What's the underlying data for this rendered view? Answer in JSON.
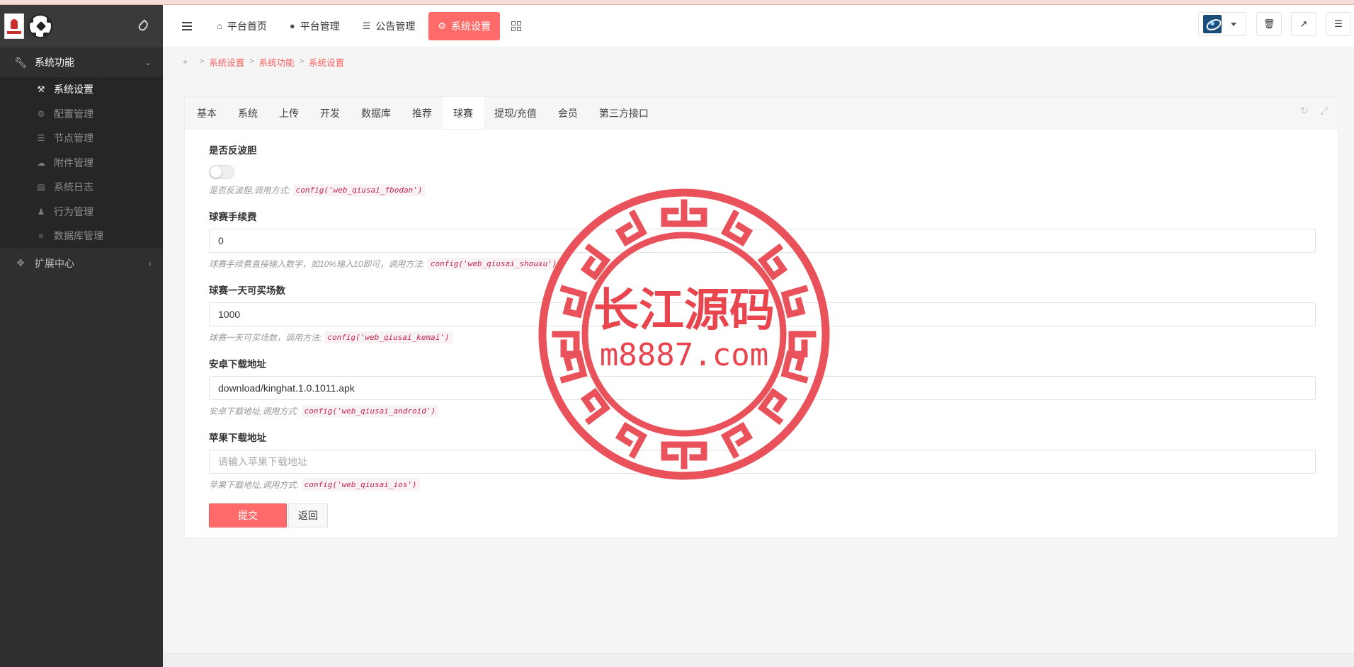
{
  "sidebar": {
    "groups": [
      {
        "label": "系统功能",
        "icon": "wrench-icon"
      },
      {
        "label": "扩展中心",
        "icon": "layers-icon"
      }
    ],
    "items": [
      {
        "label": "系统设置",
        "icon": "wrench-icon"
      },
      {
        "label": "配置管理",
        "icon": "gears-icon"
      },
      {
        "label": "节点管理",
        "icon": "list-icon"
      },
      {
        "label": "附件管理",
        "icon": "cloud-upload-icon"
      },
      {
        "label": "系统日志",
        "icon": "book-icon"
      },
      {
        "label": "行为管理",
        "icon": "user-secret-icon"
      },
      {
        "label": "数据库管理",
        "icon": "database-icon"
      }
    ]
  },
  "topbar": {
    "tabs": [
      {
        "label": "平台首页",
        "icon": "home-icon"
      },
      {
        "label": "平台管理",
        "icon": "user-icon"
      },
      {
        "label": "公告管理",
        "icon": "indent-icon"
      },
      {
        "label": "系统设置",
        "icon": "gear-icon"
      }
    ]
  },
  "breadcrumb": [
    "系统设置",
    "系统功能",
    "系统设置"
  ],
  "panel": {
    "tabs": [
      "基本",
      "系统",
      "上传",
      "开发",
      "数据库",
      "推荐",
      "球赛",
      "提现/充值",
      "会员",
      "第三方接口"
    ],
    "active_tab": "球赛"
  },
  "form": {
    "fbodan": {
      "label": "是否反波胆",
      "checked": false,
      "help": "是否反波胆,调用方式:",
      "code": "config('web_qiusai_fbodan')"
    },
    "shouxu": {
      "label": "球赛手续费",
      "value": "0",
      "help": "球赛手续费直接输入数字，如10%输入10即可，调用方法:",
      "code": "config('web_qiusai_shouxu')"
    },
    "kemai": {
      "label": "球赛一天可买场数",
      "value": "1000",
      "help": "球赛一天可买场数，调用方法:",
      "code": "config('web_qiusai_kemai')"
    },
    "android": {
      "label": "安卓下载地址",
      "value": "download/kinghat.1.0.1011.apk",
      "help": "安卓下载地址,调用方式:",
      "code": "config('web_qiusai_android')"
    },
    "ios": {
      "label": "苹果下载地址",
      "value": "",
      "placeholder": "请输入苹果下载地址",
      "help": "苹果下载地址,调用方式:",
      "code": "config('web_qiusai_ios')"
    },
    "submit_label": "提交",
    "back_label": "返回"
  },
  "watermark": {
    "line1": "长江源码",
    "line2": "m8887.com",
    "color": "#e8454e"
  },
  "colors": {
    "accent": "#ff6b6b",
    "sidebar_bg": "#2f2f2f",
    "breadcrumb": "#ff5e5e"
  }
}
